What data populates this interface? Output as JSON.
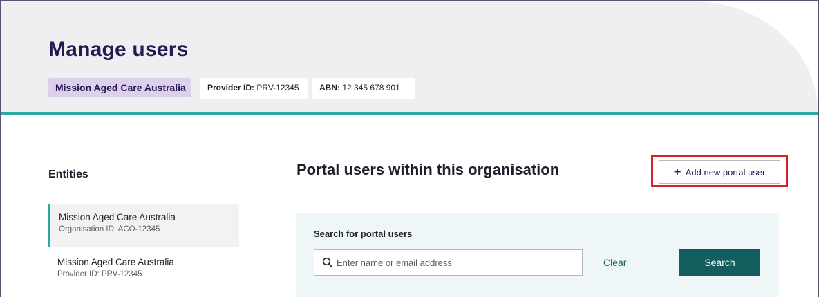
{
  "header": {
    "title": "Manage users",
    "organisation": "Mission Aged Care Australia",
    "provider_label": "Provider ID:",
    "provider_value": "PRV-12345",
    "abn_label": "ABN:",
    "abn_value": "12 345 678 901"
  },
  "sidebar": {
    "heading": "Entities",
    "items": [
      {
        "name": "Mission Aged Care Australia",
        "detail": "Organisation ID: ACO-12345",
        "selected": true
      },
      {
        "name": "Mission Aged Care Australia",
        "detail": "Provider ID: PRV-12345",
        "selected": false
      }
    ]
  },
  "main": {
    "title": "Portal users within this organisation",
    "add_button": {
      "icon": "plus-icon",
      "label": "Add new portal user",
      "highlighted": true
    },
    "search": {
      "label": "Search for portal users",
      "placeholder": "Enter name or email address",
      "value": "",
      "icon": "search-icon",
      "clear_label": "Clear",
      "button_label": "Search"
    }
  },
  "colors": {
    "brand_text": "#261a53",
    "accent_teal": "#27a9a5",
    "search_button": "#145d5f",
    "org_tag_bg": "#ddd0ea",
    "highlight_border": "#d42128"
  }
}
